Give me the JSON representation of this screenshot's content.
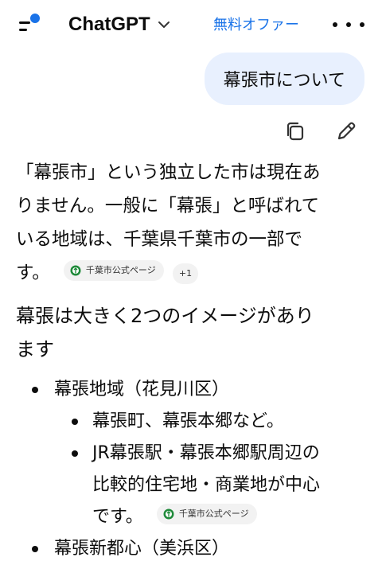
{
  "header": {
    "model_name": "ChatGPT",
    "offer_label": "無料オファー"
  },
  "user_message": "幕張市について",
  "answer": {
    "paragraph_lines": [
      "「幕張市」という独立した市は現在あ",
      "りません。一般に「幕張」と呼ばれて",
      "いる地域は、千葉県千葉市の一部で",
      "す。"
    ],
    "citation_label": "千葉市公式ページ",
    "citation_extra": "+1",
    "heading_lines": [
      "幕張は大きく2つのイメージがあり",
      "ます"
    ],
    "list": [
      {
        "label": "幕張地域（花見川区）",
        "sub": [
          "幕張町、幕張本郷など。",
          "JR幕張駅・幕張本郷駅周辺の",
          "比較的住宅地・商業地が中心",
          "です。"
        ],
        "sub_citation": "千葉市公式ページ"
      },
      {
        "label": "幕張新都心（美浜区）"
      }
    ]
  },
  "colors": {
    "accent": "#1a73e8",
    "user_bubble": "#e8f0fe",
    "chip_bg": "#f2f2f2",
    "text": "#0d0d0d",
    "seal_green": "#1f8a3a"
  }
}
